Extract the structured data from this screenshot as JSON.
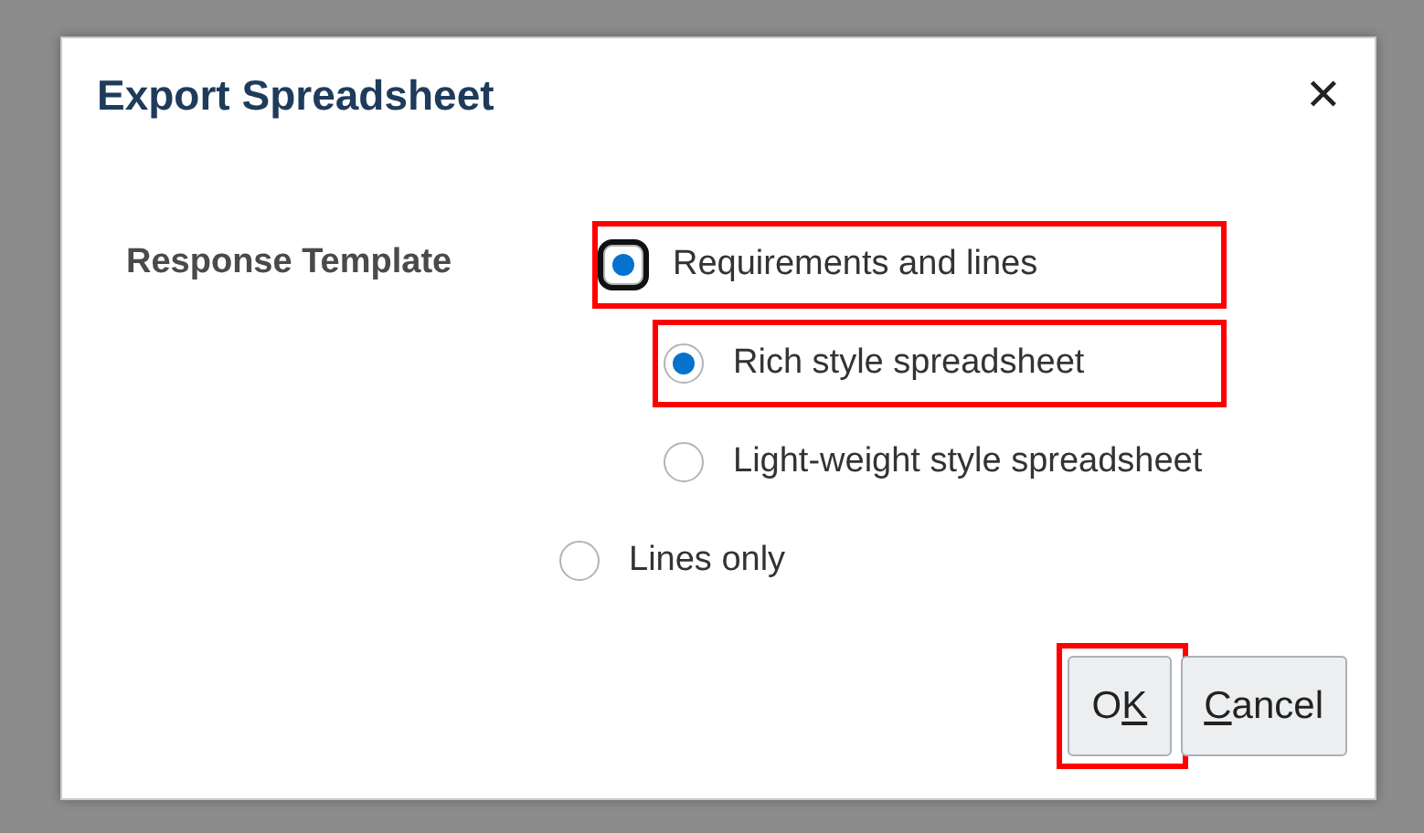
{
  "dialog": {
    "title": "Export Spreadsheet",
    "close": "✕"
  },
  "field": {
    "label": "Response Template",
    "options": [
      {
        "label": "Requirements and lines",
        "selected": true,
        "focused": true,
        "highlighted": true,
        "children": [
          {
            "label": "Rich style spreadsheet",
            "selected": true,
            "highlighted": true
          },
          {
            "label": "Light-weight style spreadsheet",
            "selected": false,
            "highlighted": false
          }
        ]
      },
      {
        "label": "Lines only",
        "selected": false,
        "focused": false,
        "highlighted": false
      }
    ]
  },
  "buttons": [
    {
      "before": "O",
      "mnemonic": "K",
      "highlighted": true
    },
    {
      "mnemonic": "C",
      "after": "ancel",
      "highlighted": false
    }
  ]
}
